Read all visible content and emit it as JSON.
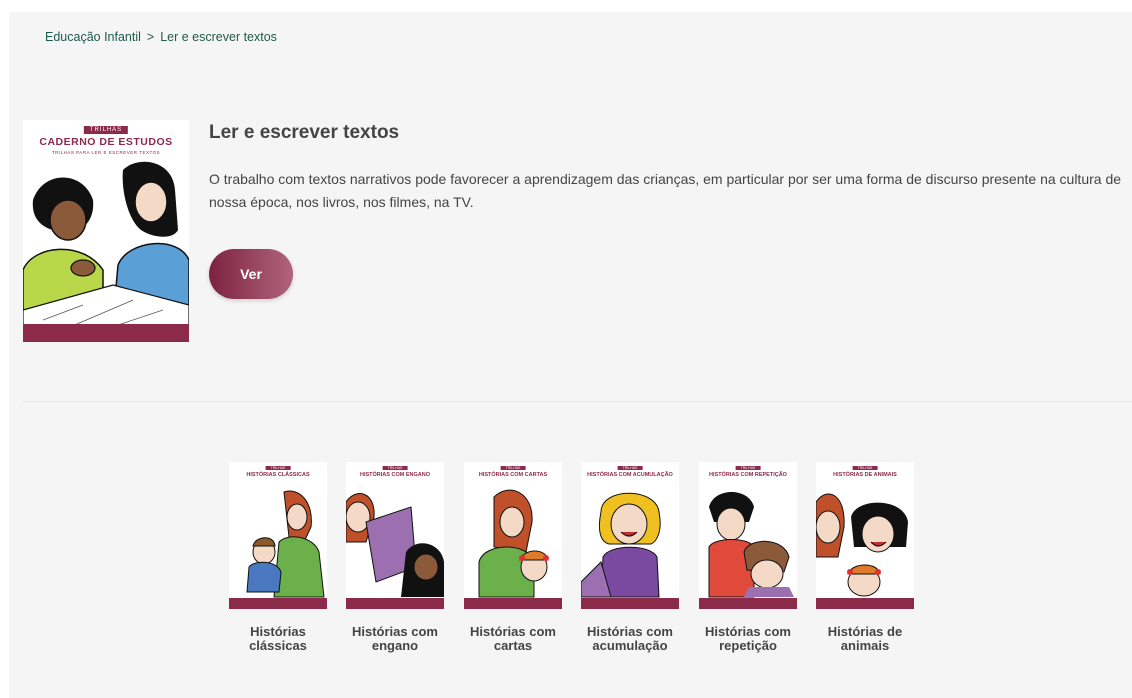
{
  "breadcrumb": {
    "items": [
      "Educação Infantil",
      "Ler e escrever textos"
    ],
    "separator": ">"
  },
  "hero": {
    "cover_tag": "TRILHAS",
    "cover_title": "CADERNO DE ESTUDOS",
    "cover_subtitle": "TRILHAS PARA LER E ESCREVER TEXTOS",
    "title": "Ler e escrever textos",
    "description": "O trabalho com textos narrativos pode favorecer a aprendizagem das crianças, em particular por ser uma forma de discurso presente na cultura de nossa época, nos livros, nos filmes, na TV.",
    "button_label": "Ver"
  },
  "books": [
    {
      "cover_title": "HISTÓRIAS CLÁSSICAS",
      "label": "Histórias clássicas"
    },
    {
      "cover_title": "HISTÓRIAS COM ENGANO",
      "label": "Histórias com engano"
    },
    {
      "cover_title": "HISTÓRIAS COM CARTAS",
      "label": "Histórias com cartas"
    },
    {
      "cover_title": "HISTÓRIAS COM ACUMULAÇÃO",
      "label": "Histórias com acumulação"
    },
    {
      "cover_title": "HISTÓRIAS COM REPETIÇÃO",
      "label": "Histórias com repetição"
    },
    {
      "cover_title": "HISTÓRIAS DE ANIMAIS",
      "label": "Histórias de animais"
    }
  ],
  "book_tag": "TRILHAS",
  "colors": {
    "brand": "#8c2a4a",
    "breadcrumb": "#1f5a4a",
    "text": "#444444",
    "background": "#f5f5f5"
  }
}
